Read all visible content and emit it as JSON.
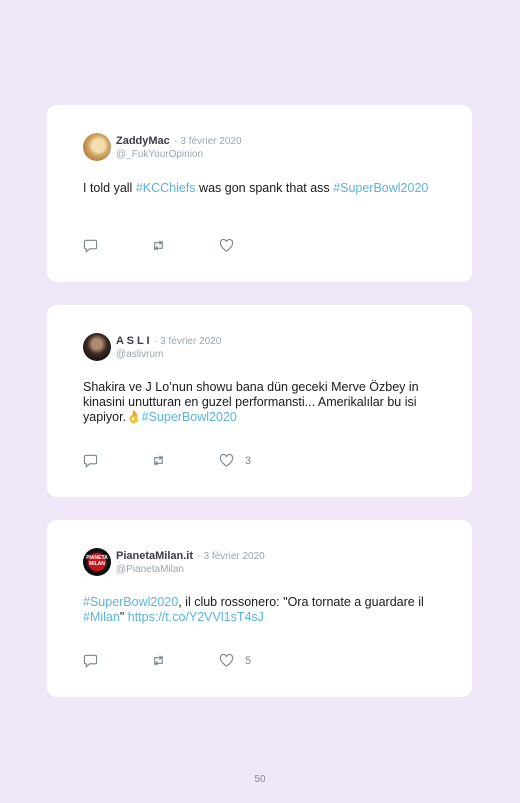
{
  "tweets": [
    {
      "name": "ZaddyMac",
      "date": "· 3 février 2020",
      "handle": "@_FukYourOpinion",
      "text": [
        {
          "t": "I told yall ",
          "link": false
        },
        {
          "t": "#KCChiefs",
          "link": true
        },
        {
          "t": " was gon spank that ass ",
          "link": false
        },
        {
          "t": "#SuperBowl2020",
          "link": true
        }
      ],
      "likes": ""
    },
    {
      "name": "A S L I",
      "date": "· 3 février 2020",
      "handle": "@aslivrum",
      "text": [
        {
          "t": "Shakira ve J Lo’nun showu bana dün geceki Merve Özbey in kinasini unutturan en guzel performansti... Amerikalılar bu isi yapiyor.👌",
          "link": false
        },
        {
          "t": "#SuperBowl2020",
          "link": true
        }
      ],
      "likes": "3"
    },
    {
      "name": "PianetaMilan.it",
      "date": "· 3 février 2020",
      "handle": "@PianetaMilan",
      "avatar_text": "PIANETA MILAN",
      "text": [
        {
          "t": "#SuperBowl2020",
          "link": true
        },
        {
          "t": ", il club rossonero: \"Ora tornate a guardare il ",
          "link": false
        },
        {
          "t": "#Milan",
          "link": true
        },
        {
          "t": "\" ",
          "link": false
        },
        {
          "t": "https://t.co/Y2VVl1sT4sJ",
          "link": true
        }
      ],
      "likes": "5"
    }
  ],
  "page_number": "50",
  "icons": {
    "reply": "reply-icon",
    "retweet": "retweet-icon",
    "like": "heart-icon"
  },
  "colors": {
    "background": "#efe6f8",
    "link": "#5ab4de",
    "meta": "#9aa5b0"
  }
}
